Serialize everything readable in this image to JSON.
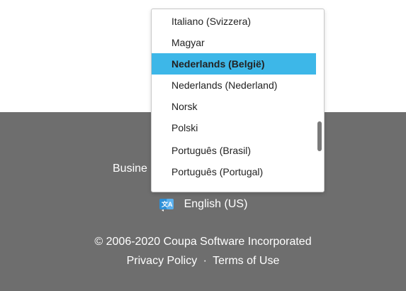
{
  "dropdown": {
    "options": [
      "Italiano (Svizzera)",
      "Magyar",
      "Nederlands (België)",
      "Nederlands (Nederland)",
      "Norsk",
      "Polski",
      "Português (Brasil)",
      "Português (Portugal)"
    ],
    "selected": "Nederlands (België)"
  },
  "footer": {
    "business_partial": "Busine",
    "language": "English (US)",
    "language_icon": "translate-icon",
    "copyright": "© 2006-2020 Coupa Software Incorporated",
    "privacy_policy": "Privacy Policy",
    "separator": "·",
    "terms_of_use": "Terms of Use"
  },
  "colors": {
    "footer_bg": "#6e6e6e",
    "selected_bg": "#3db7e8",
    "icon_blue": "#2e8fd6"
  }
}
